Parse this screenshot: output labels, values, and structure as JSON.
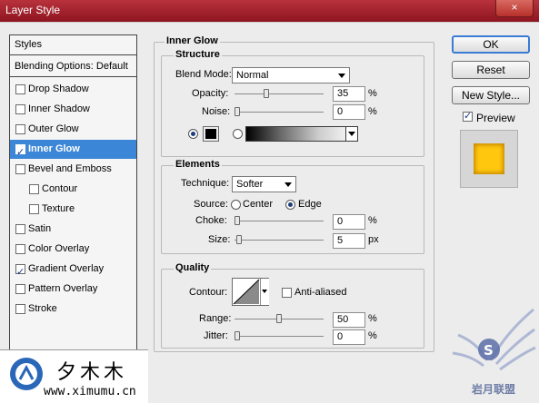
{
  "window": {
    "title": "Layer Style",
    "close_symbol": "×"
  },
  "left_panel": {
    "styles_header": "Styles",
    "blending_options": "Blending Options: Default",
    "items": [
      {
        "label": "Drop Shadow",
        "checked": false,
        "selected": false,
        "indent": false
      },
      {
        "label": "Inner Shadow",
        "checked": false,
        "selected": false,
        "indent": false
      },
      {
        "label": "Outer Glow",
        "checked": false,
        "selected": false,
        "indent": false
      },
      {
        "label": "Inner Glow",
        "checked": true,
        "selected": true,
        "indent": false
      },
      {
        "label": "Bevel and Emboss",
        "checked": false,
        "selected": false,
        "indent": false
      },
      {
        "label": "Contour",
        "checked": false,
        "selected": false,
        "indent": true
      },
      {
        "label": "Texture",
        "checked": false,
        "selected": false,
        "indent": true
      },
      {
        "label": "Satin",
        "checked": false,
        "selected": false,
        "indent": false
      },
      {
        "label": "Color Overlay",
        "checked": false,
        "selected": false,
        "indent": false
      },
      {
        "label": "Gradient Overlay",
        "checked": true,
        "selected": false,
        "indent": false
      },
      {
        "label": "Pattern Overlay",
        "checked": false,
        "selected": false,
        "indent": false
      },
      {
        "label": "Stroke",
        "checked": false,
        "selected": false,
        "indent": false
      }
    ]
  },
  "inner_glow": {
    "title": "Inner Glow",
    "structure": {
      "title": "Structure",
      "blend_mode_label": "Blend Mode:",
      "blend_mode_value": "Normal",
      "opacity_label": "Opacity:",
      "opacity_value": "35",
      "opacity_unit": "%",
      "opacity_level": 0.35,
      "noise_label": "Noise:",
      "noise_value": "0",
      "noise_unit": "%",
      "noise_level": 0,
      "glow_color": "#000000"
    },
    "elements": {
      "title": "Elements",
      "technique_label": "Technique:",
      "technique_value": "Softer",
      "source_label": "Source:",
      "source_center": "Center",
      "source_edge": "Edge",
      "choke_label": "Choke:",
      "choke_value": "0",
      "choke_unit": "%",
      "choke_level": 0,
      "size_label": "Size:",
      "size_value": "5",
      "size_unit": "px",
      "size_level": 0.02
    },
    "quality": {
      "title": "Quality",
      "contour_label": "Contour:",
      "anti_aliased_label": "Anti-aliased",
      "range_label": "Range:",
      "range_value": "50",
      "range_unit": "%",
      "range_level": 0.5,
      "jitter_label": "Jitter:",
      "jitter_value": "0",
      "jitter_unit": "%",
      "jitter_level": 0
    }
  },
  "buttons": {
    "ok": "OK",
    "reset": "Reset",
    "new_style": "New Style...",
    "preview_label": "Preview"
  },
  "preview_color": "#ffc80f",
  "watermark": {
    "logo_cn": "夕木木",
    "url": "www.ximumu.cn",
    "brand_cn": "岩月联盟"
  }
}
